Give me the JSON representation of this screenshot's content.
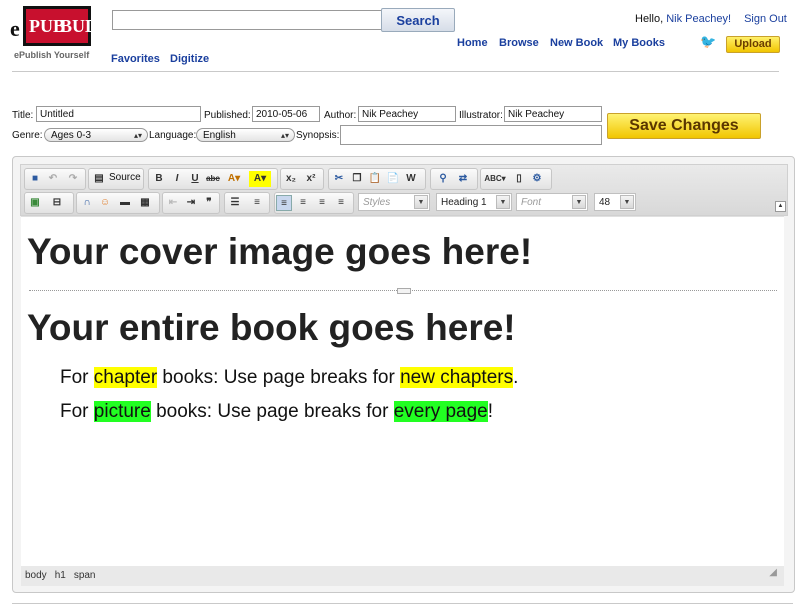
{
  "header": {
    "logo": {
      "e": "e",
      "pub": "PUB",
      "bud": "BUD",
      "tagline": "ePublish Yourself"
    },
    "search": {
      "value": "",
      "button_label": "Search"
    },
    "nav_left": [
      "Favorites",
      "Digitize"
    ],
    "nav_right": [
      "Home",
      "Browse",
      "New Book",
      "My Books"
    ],
    "greeting_prefix": "Hello,",
    "user_name": "Nik Peachey!",
    "sign_out": "Sign Out",
    "upload_label": "Upload"
  },
  "form": {
    "title_label": "Title:",
    "title_value": "Untitled",
    "published_label": "Published:",
    "published_value": "2010-05-06",
    "author_label": "Author:",
    "author_value": "Nik Peachey",
    "illustrator_label": "Illustrator:",
    "illustrator_value": "Nik Peachey",
    "genre_label": "Genre:",
    "genre_value": "Ages 0-3",
    "language_label": "Language:",
    "language_value": "English",
    "synopsis_label": "Synopsis:",
    "synopsis_value": "",
    "save_label": "Save Changes"
  },
  "toolbar": {
    "source_label": "Source",
    "styles_placeholder": "Styles",
    "format_value": "Heading 1",
    "font_placeholder": "Font",
    "size_value": "48"
  },
  "document": {
    "cover_heading": "Your cover image goes here!",
    "book_heading": "Your entire book goes here!",
    "line1": {
      "pre": "For ",
      "hl1": "chapter",
      "mid": " books: Use page breaks for ",
      "hl2": "new chapters",
      "post": "."
    },
    "line2": {
      "pre": "For ",
      "hl1": "picture",
      "mid": " books: Use page breaks for ",
      "hl2": "every page",
      "post": "!"
    }
  },
  "statusbar": [
    "body",
    "h1",
    "span"
  ],
  "colors": {
    "link": "#1a3f9e",
    "highlight_yellow": "#ffff00",
    "highlight_green": "#22ff22",
    "save_button": "#f1c500"
  }
}
